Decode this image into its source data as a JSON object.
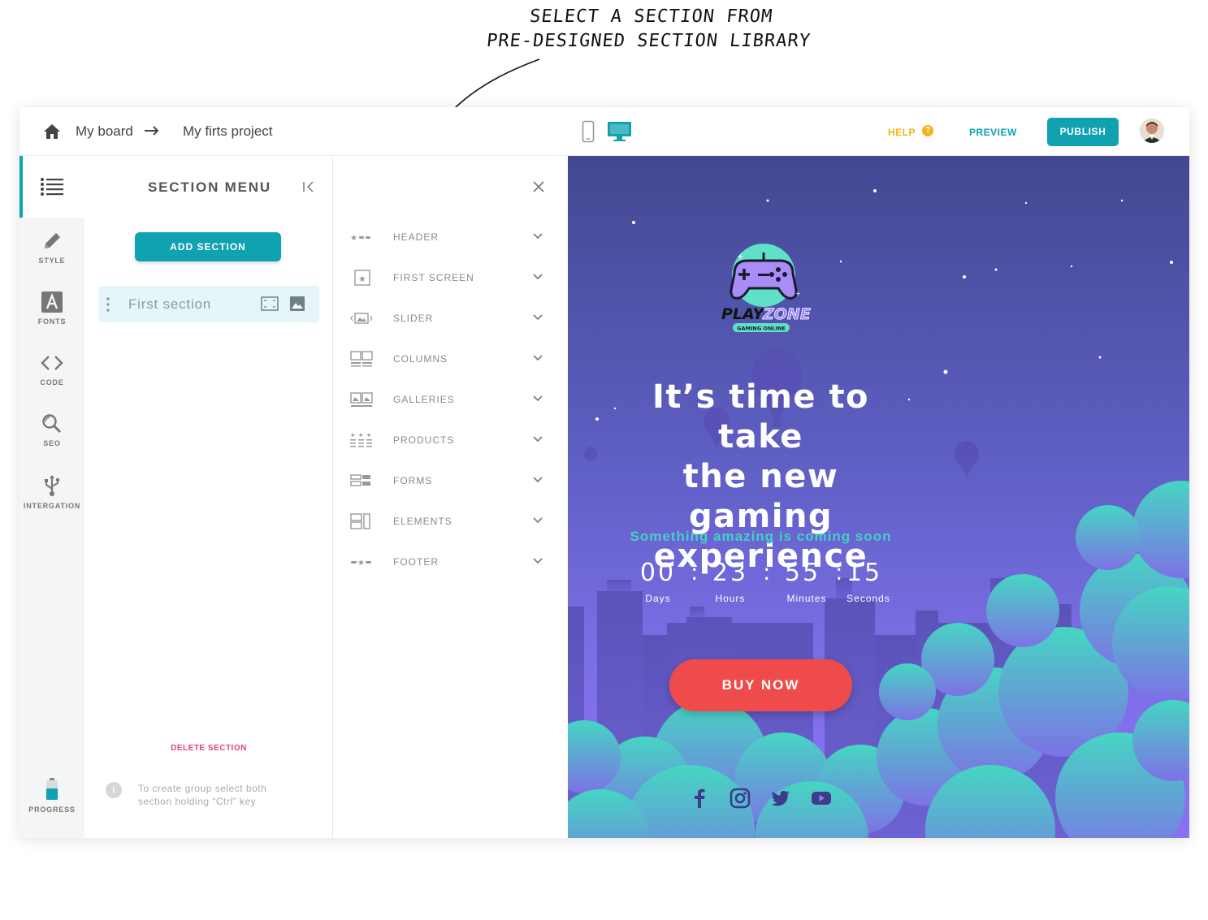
{
  "annotation": {
    "line1": "SELECT A SECTION FROM",
    "line2": "PRE-DESIGNED SECTION LIBRARY"
  },
  "topbar": {
    "breadcrumb_1": "My board",
    "breadcrumb_2": "My firts project",
    "help_label": "HELP",
    "help_icon_text": "?",
    "preview_label": "PREVIEW",
    "publish_label": "PUBLISH"
  },
  "tools": [
    {
      "label": "STYLE",
      "icon": "pencil-icon"
    },
    {
      "label": "FONTS",
      "icon": "fonts-icon"
    },
    {
      "label": "CODE",
      "icon": "code-icon"
    },
    {
      "label": "SEO",
      "icon": "seo-search-icon"
    },
    {
      "label": "INTERGATION",
      "icon": "usb-icon"
    }
  ],
  "progress_label": "PROGRESS",
  "section_menu": {
    "title": "SECTION MENU",
    "add_section_label": "ADD SECTION",
    "sections": [
      {
        "name": "First section"
      }
    ],
    "delete_label": "DELETE SECTION",
    "info_icon_text": "i",
    "hint": "To create group select both section holding “Ctrl” key"
  },
  "library": {
    "items": [
      {
        "label": "HEADER",
        "icon": "header-icon"
      },
      {
        "label": "FIRST SCREEN",
        "icon": "first-screen-icon"
      },
      {
        "label": "SLIDER",
        "icon": "slider-icon"
      },
      {
        "label": "COLUMNS",
        "icon": "columns-icon"
      },
      {
        "label": "GALLERIES",
        "icon": "galleries-icon"
      },
      {
        "label": "PRODUCTS",
        "icon": "products-icon"
      },
      {
        "label": "FORMS",
        "icon": "forms-icon"
      },
      {
        "label": "ELEMENTS",
        "icon": "elements-icon"
      },
      {
        "label": "FOOTER",
        "icon": "footer-icon"
      }
    ]
  },
  "preview": {
    "logo_text_1": "PLAY",
    "logo_text_2": "ZONE",
    "logo_tagline": "GAMING ONLINE",
    "headline_1": "It’s time to take",
    "headline_2": "the new gaming",
    "headline_3": "experience",
    "subline": "Something amazing is coming soon",
    "countdown": [
      {
        "value": "00",
        "label": "Days"
      },
      {
        "value": "23",
        "label": "Hours"
      },
      {
        "value": "55",
        "label": "Minutes"
      },
      {
        "value": "15",
        "label": "Seconds"
      }
    ],
    "separator": ":",
    "buy_label": "BUY NOW",
    "social": [
      "facebook-icon",
      "instagram-icon",
      "twitter-icon",
      "youtube-icon"
    ]
  },
  "colors": {
    "accent": "#11a2b2",
    "help": "#f2b418",
    "delete": "#e0457b",
    "buy_button": "#ef4b4b",
    "canvas_top": "#434891",
    "canvas_bottom": "#8b70f1",
    "cloud": "#43d1c3"
  }
}
